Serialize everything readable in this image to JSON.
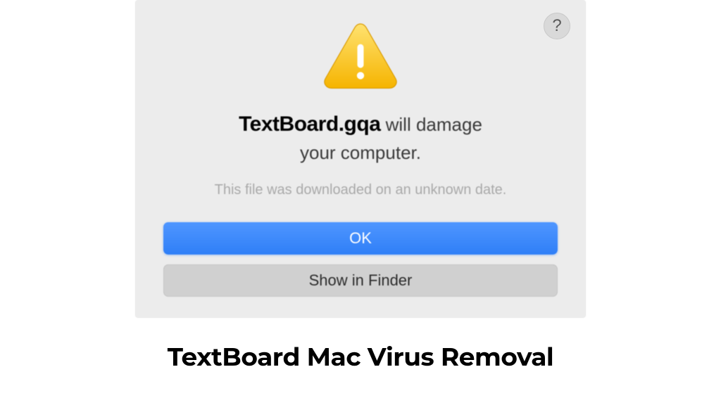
{
  "dialog": {
    "help": "?",
    "app_name": "TextBoard.gqa",
    "message_suffix_1": " will damage",
    "message_line2": "your computer.",
    "subtext": "This file was downloaded on an unknown date.",
    "ok_label": "OK",
    "show_label": "Show in Finder"
  },
  "page": {
    "caption": "TextBoard Mac Virus Removal"
  }
}
